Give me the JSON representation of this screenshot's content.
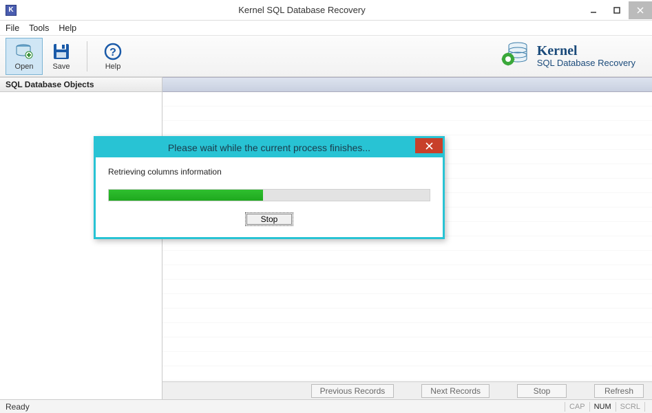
{
  "window": {
    "title": "Kernel SQL Database Recovery",
    "app_letter": "K"
  },
  "menu": {
    "file": "File",
    "tools": "Tools",
    "help": "Help"
  },
  "toolbar": {
    "open": "Open",
    "save": "Save",
    "help": "Help"
  },
  "brand": {
    "name": "Kernel",
    "sub": "SQL Database Recovery"
  },
  "sidebar": {
    "header": "SQL Database Objects"
  },
  "bottom": {
    "previous": "Previous Records",
    "next": "Next Records",
    "stop": "Stop",
    "refresh": "Refresh"
  },
  "status": {
    "ready": "Ready",
    "cap": "CAP",
    "num": "NUM",
    "scrl": "SCRL"
  },
  "dialog": {
    "title": "Please wait while the current process finishes...",
    "message": "Retrieving columns information",
    "progress_percent": 48,
    "stop": "Stop"
  }
}
